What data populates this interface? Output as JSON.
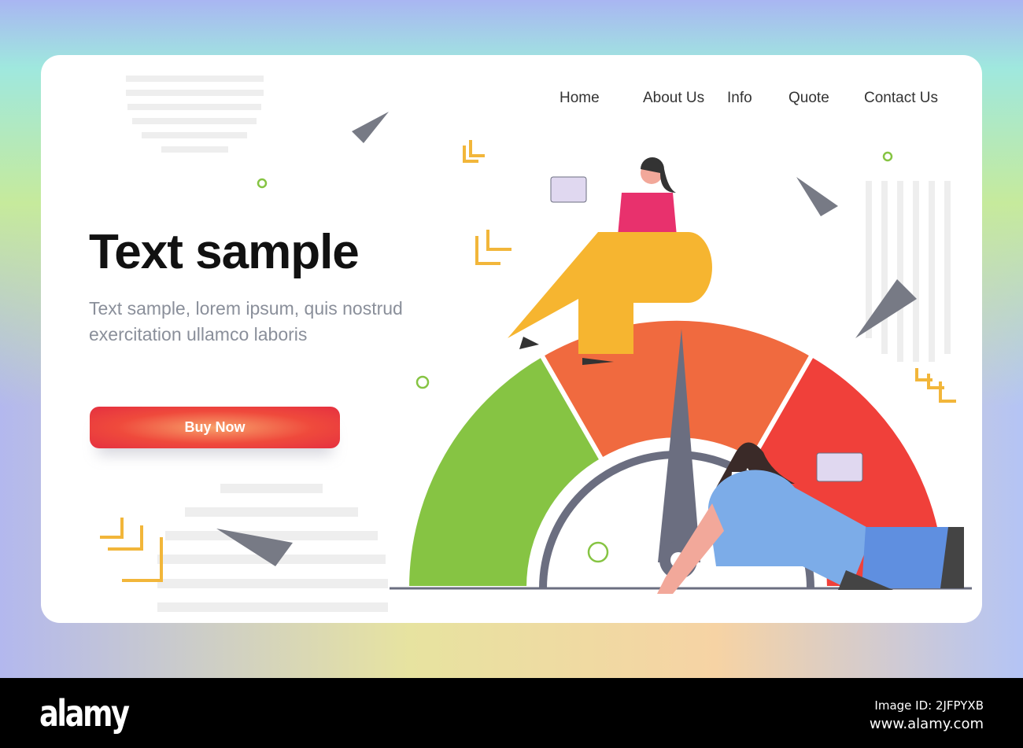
{
  "nav": {
    "items": [
      "Home",
      "About Us",
      "Info",
      "Quote",
      "Contact Us"
    ]
  },
  "hero": {
    "title": "Text sample",
    "subtitle": "Text sample, lorem ipsum, quis nostrud exercitation ullamco laboris",
    "button": "Buy Now"
  },
  "illustration": {
    "gauge_segments": [
      "#86c443",
      "#f06a3f",
      "#f0403a"
    ],
    "needle_color": "#6b6e80",
    "watermark": "alamy"
  },
  "footer": {
    "logo": "alamy",
    "image_id": "Image ID: 2JFPYXB",
    "url": "www.alamy.com"
  }
}
